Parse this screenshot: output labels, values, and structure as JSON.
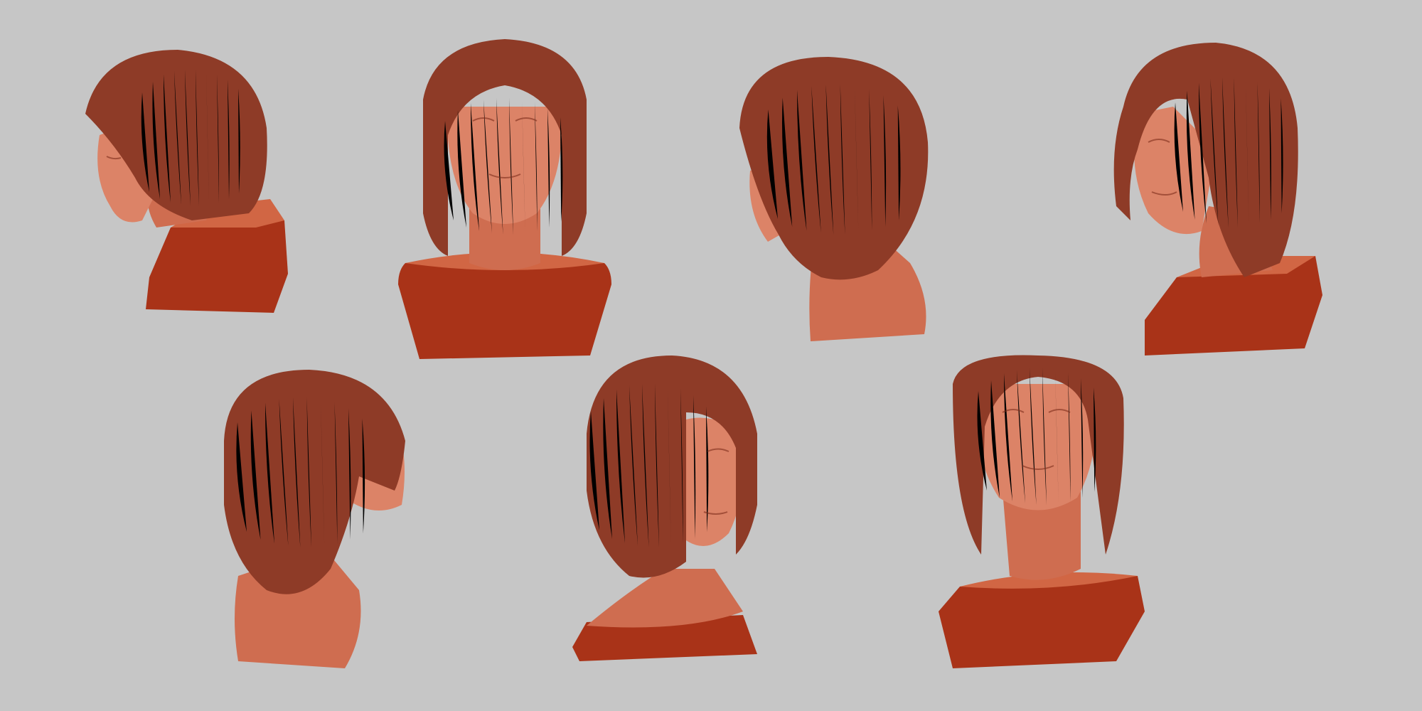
{
  "scene": {
    "background_color": "#c6c6c6",
    "material_color": "#b5452a",
    "busts": [
      {
        "view": "left-profile"
      },
      {
        "view": "front-low-angle"
      },
      {
        "view": "back-three-quarter-left"
      },
      {
        "view": "left-three-quarter"
      },
      {
        "view": "back-three-quarter-right"
      },
      {
        "view": "right-three-quarter"
      },
      {
        "view": "front-low-angle-tilted"
      }
    ]
  }
}
